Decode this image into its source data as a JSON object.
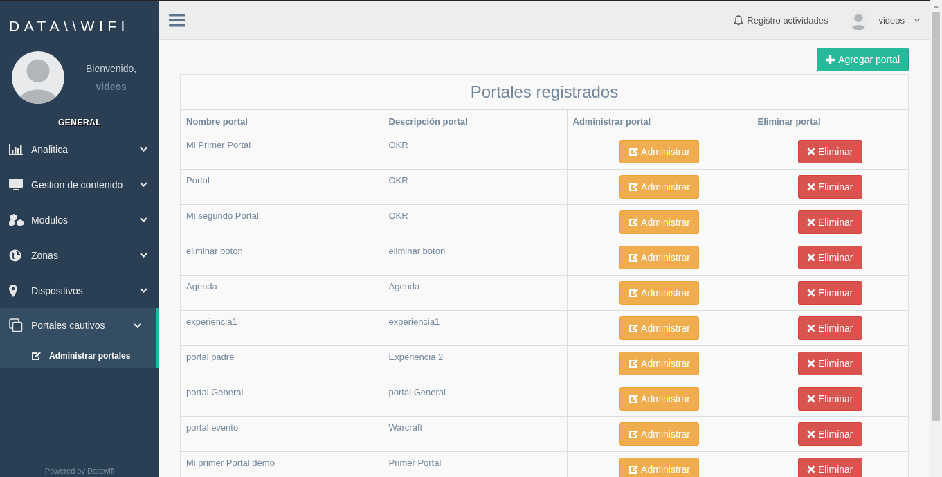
{
  "sidebar": {
    "brand": "DATA\\\\WIFI",
    "welcome": "Bienvenido,",
    "username": "videos",
    "section_title": "GENERAL",
    "menu": [
      {
        "label": "Analitica",
        "active": false
      },
      {
        "label": "Gestion de contenido",
        "active": false
      },
      {
        "label": "Modulos",
        "active": false
      },
      {
        "label": "Zonas",
        "active": false
      },
      {
        "label": "Dispositivos",
        "active": false
      },
      {
        "label": "Portales cautivos",
        "active": true,
        "children": [
          {
            "label": "Administrar portales",
            "selected": true
          }
        ]
      }
    ],
    "footer": "Powered by Datawifi"
  },
  "topbar": {
    "activity_link": "Registro actividades",
    "user": "videos"
  },
  "add_button": "Agregar portal",
  "table": {
    "title": "Portales registrados",
    "columns": [
      "Nombre portal",
      "Descripción portal",
      "Administrar portal",
      "Eliminar portal"
    ],
    "rows": [
      {
        "name": "Mi Primer Portal",
        "description": "OKR",
        "manage": "Administrar",
        "delete": "Eliminar"
      },
      {
        "name": "Portal",
        "description": "OKR",
        "manage": "Administrar",
        "delete": "Eliminar"
      },
      {
        "name": "Mi segundo Portal.",
        "description": "OKR",
        "manage": "Administrar",
        "delete": "Eliminar"
      },
      {
        "name": "eliminar boton",
        "description": "eliminar boton",
        "manage": "Administrar",
        "delete": "Eliminar"
      },
      {
        "name": "Agenda",
        "description": "Agenda",
        "manage": "Administrar",
        "delete": "Eliminar"
      },
      {
        "name": "experiencia1",
        "description": "experiencia1",
        "manage": "Administrar",
        "delete": "Eliminar"
      },
      {
        "name": "portal padre",
        "description": "Experiencia 2",
        "manage": "Administrar",
        "delete": "Eliminar"
      },
      {
        "name": "portal General",
        "description": "portal General",
        "manage": "Administrar",
        "delete": "Eliminar"
      },
      {
        "name": "portal evento",
        "description": "Warcraft",
        "manage": "Administrar",
        "delete": "Eliminar"
      },
      {
        "name": "Mi primer Portal demo",
        "description": "Primer Portal",
        "manage": "Administrar",
        "delete": "Eliminar"
      }
    ]
  }
}
